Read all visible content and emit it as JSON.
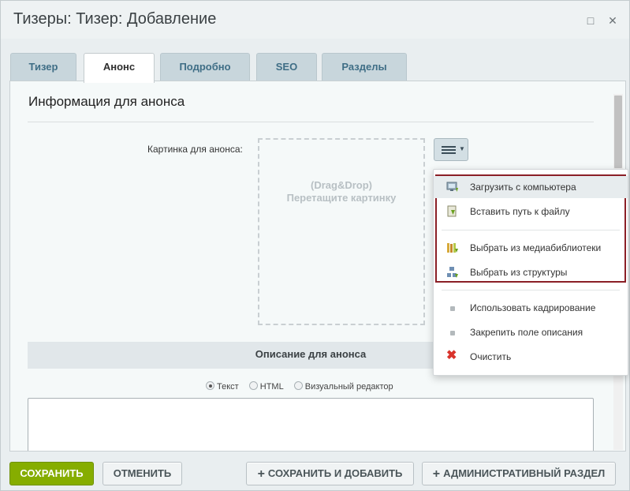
{
  "window": {
    "title": "Тизеры: Тизер: Добавление",
    "maximize_icon": "□",
    "close_icon": "✕"
  },
  "tabs": [
    {
      "label": "Тизер",
      "active": false
    },
    {
      "label": "Анонс",
      "active": true
    },
    {
      "label": "Подробно",
      "active": false
    },
    {
      "label": "SEO",
      "active": false
    },
    {
      "label": "Разделы",
      "active": false
    }
  ],
  "content": {
    "section_title": "Информация для анонса",
    "picture_label": "Картинка для анонса:",
    "dropzone_line1": "(Drag&Drop)",
    "dropzone_line2": "Перетащите картинку",
    "description_title": "Описание для анонса",
    "radio_options": [
      {
        "label": "Текст",
        "selected": true
      },
      {
        "label": "HTML",
        "selected": false
      },
      {
        "label": "Визуальный редактор",
        "selected": false
      }
    ]
  },
  "dropdown_menu": {
    "items": [
      {
        "label": "Загрузить с компьютера",
        "icon": "upload-computer-icon"
      },
      {
        "label": "Вставить путь к файлу",
        "icon": "insert-path-icon"
      },
      {
        "label": "Выбрать из медиабиблиотеки",
        "icon": "medialibrary-icon"
      },
      {
        "label": "Выбрать из структуры",
        "icon": "structure-icon"
      },
      {
        "label": "Использовать кадрирование",
        "icon": "bullet-icon"
      },
      {
        "label": "Закрепить поле описания",
        "icon": "bullet-icon"
      },
      {
        "label": "Очистить",
        "icon": "clear-icon"
      }
    ]
  },
  "footer": {
    "save": "СОХРАНИТЬ",
    "cancel": "ОТМЕНИТЬ",
    "save_add": "СОХРАНИТЬ И ДОБАВИТЬ",
    "admin_section": "АДМИНИСТРАТИВНЫЙ РАЗДЕЛ"
  },
  "colors": {
    "accent_green": "#86ad00",
    "tab_text": "#3f6e86",
    "highlight_border": "#8b1f26",
    "clear_red": "#d9332b"
  }
}
